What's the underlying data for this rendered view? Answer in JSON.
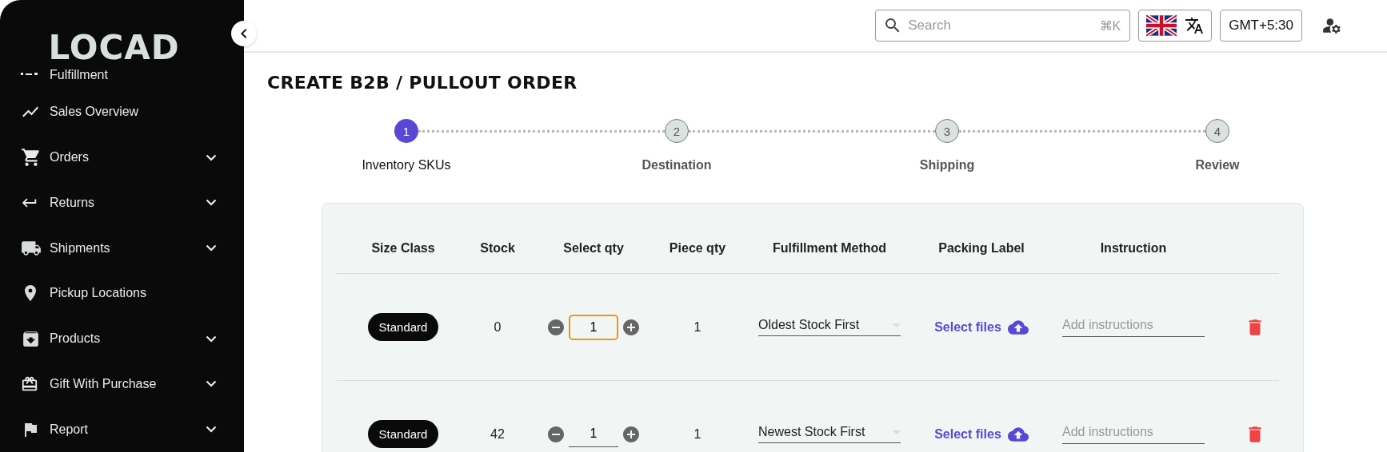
{
  "sidebar": {
    "logo": "LOCAD",
    "items": [
      {
        "label": "Fulfillment",
        "kind": "link"
      },
      {
        "label": "Sales Overview",
        "kind": "link"
      },
      {
        "label": "Orders",
        "kind": "group"
      },
      {
        "label": "Returns",
        "kind": "group"
      },
      {
        "label": "Shipments",
        "kind": "group"
      },
      {
        "label": "Pickup Locations",
        "kind": "link"
      },
      {
        "label": "Products",
        "kind": "group"
      },
      {
        "label": "Gift With Purchase",
        "kind": "group"
      },
      {
        "label": "Report",
        "kind": "group"
      }
    ]
  },
  "header": {
    "search": {
      "placeholder": "Search",
      "shortcut": "⌘K"
    },
    "timezone": "GMT+5:30"
  },
  "title": "CREATE B2B / PULLOUT ORDER",
  "steps": [
    {
      "number": "1",
      "label": "Inventory SKUs",
      "selected": true
    },
    {
      "number": "2",
      "label": "Destination",
      "selected": false
    },
    {
      "number": "3",
      "label": "Shipping",
      "selected": false
    },
    {
      "number": "4",
      "label": "Review",
      "selected": false
    }
  ],
  "table": {
    "columns": [
      "Size Class",
      "Stock",
      "Select qty",
      "Piece qty",
      "Fulfillment Method",
      "Packing Label",
      "Instruction"
    ],
    "rows": [
      {
        "size_class": "Standard",
        "stock": "0",
        "qty": "1",
        "qty_focused": true,
        "piece_qty": "1",
        "method": "Oldest Stock First",
        "packing_label": "Select files",
        "instruction_placeholder": "Add instructions"
      },
      {
        "size_class": "Standard",
        "stock": "42",
        "qty": "1",
        "qty_focused": false,
        "piece_qty": "1",
        "method": "Newest Stock First",
        "packing_label": "Select files",
        "instruction_placeholder": "Add instructions"
      }
    ]
  }
}
